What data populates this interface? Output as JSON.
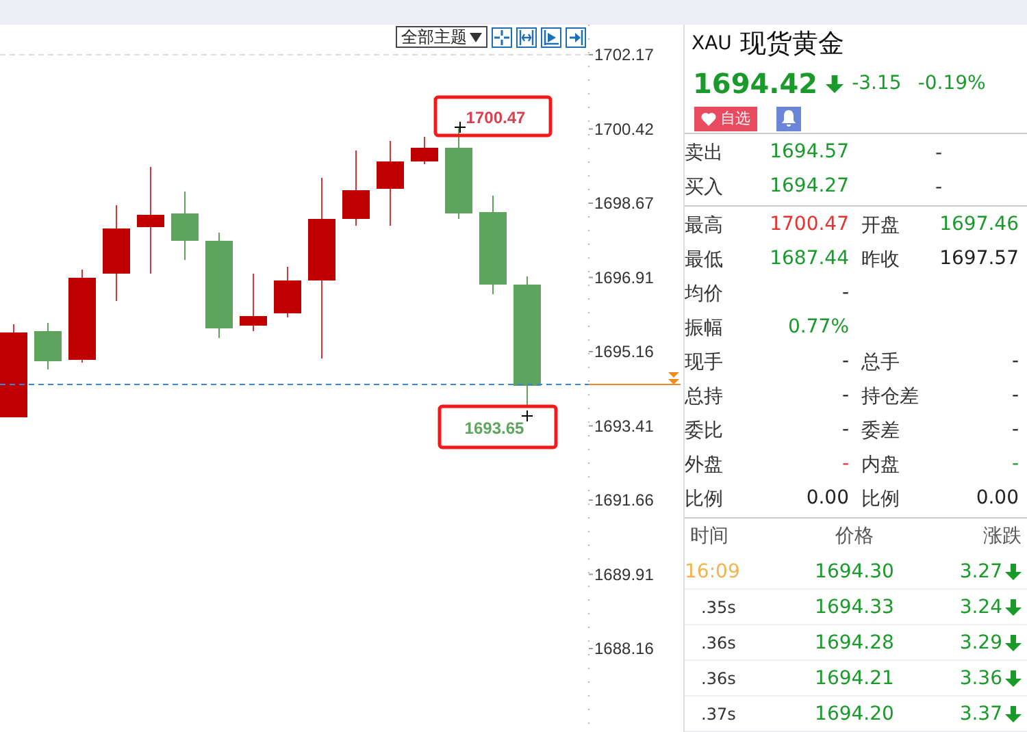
{
  "toolbar": {
    "theme_select": "全部主题",
    "tools": [
      {
        "kind": "crosshair"
      },
      {
        "kind": "fit"
      },
      {
        "kind": "play"
      },
      {
        "kind": "end"
      }
    ]
  },
  "chart": {
    "y_labels": [
      "1702.17",
      "1700.42",
      "1698.67",
      "1696.91",
      "1695.16",
      "1693.41",
      "1691.66",
      "1689.91",
      "1688.16"
    ],
    "high_marker": "1700.47",
    "low_marker": "1693.65"
  },
  "quote": {
    "symbol": "XAU",
    "name": "现货黄金",
    "price": "1694.42",
    "falling": true,
    "change": "-3.15",
    "change_pct": "-0.19%",
    "watch_button": "自选"
  },
  "bid_ask": [
    {
      "label": "卖出",
      "value": "1694.57",
      "extra": "-"
    },
    {
      "label": "买入",
      "value": "1694.27",
      "extra": "-"
    }
  ],
  "stats": [
    [
      {
        "label": "最高",
        "value": "1700.47",
        "color": "#e8322f"
      },
      {
        "label": "开盘",
        "value": "1697.46",
        "color": "#1a9a2a"
      }
    ],
    [
      {
        "label": "最低",
        "value": "1687.44",
        "color": "#1a9a2a"
      },
      {
        "label": "昨收",
        "value": "1697.57",
        "color": "#222222"
      }
    ],
    [
      {
        "label": "均价",
        "value": "-",
        "color": "#222222"
      }
    ],
    [
      {
        "label": "振幅",
        "value": "0.77%",
        "color": "#1a9a2a"
      }
    ],
    [
      {
        "label": "现手",
        "value": "-",
        "color": "#222222"
      },
      {
        "label": "总手",
        "value": "-",
        "color": "#222222"
      }
    ],
    [
      {
        "label": "总持",
        "value": "-",
        "color": "#222222"
      },
      {
        "label": "持仓差",
        "value": "-",
        "color": "#222222"
      }
    ],
    [
      {
        "label": "委比",
        "value": "-",
        "color": "#222222"
      },
      {
        "label": "委差",
        "value": "-",
        "color": "#222222"
      }
    ],
    [
      {
        "label": "外盘",
        "value": "-",
        "color": "#e8322f"
      },
      {
        "label": "内盘",
        "value": "-",
        "color": "#1a9a2a"
      }
    ],
    [
      {
        "label": "比例",
        "value": "0.00",
        "color": "#222222"
      },
      {
        "label": "比例",
        "value": "0.00",
        "color": "#222222"
      }
    ]
  ],
  "ticks": {
    "columns": [
      "时间",
      "价格",
      "涨跌"
    ],
    "rows": [
      {
        "time": "16:09",
        "highlight": true,
        "price": "1694.30",
        "change": "3.27",
        "falling": true
      },
      {
        "time": ".35s",
        "highlight": false,
        "price": "1694.33",
        "change": "3.24",
        "falling": true
      },
      {
        "time": ".36s",
        "highlight": false,
        "price": "1694.28",
        "change": "3.29",
        "falling": true
      },
      {
        "time": ".36s",
        "highlight": false,
        "price": "1694.21",
        "change": "3.36",
        "falling": true
      },
      {
        "time": ".37s",
        "highlight": false,
        "price": "1694.20",
        "change": "3.37",
        "falling": true
      }
    ]
  }
}
